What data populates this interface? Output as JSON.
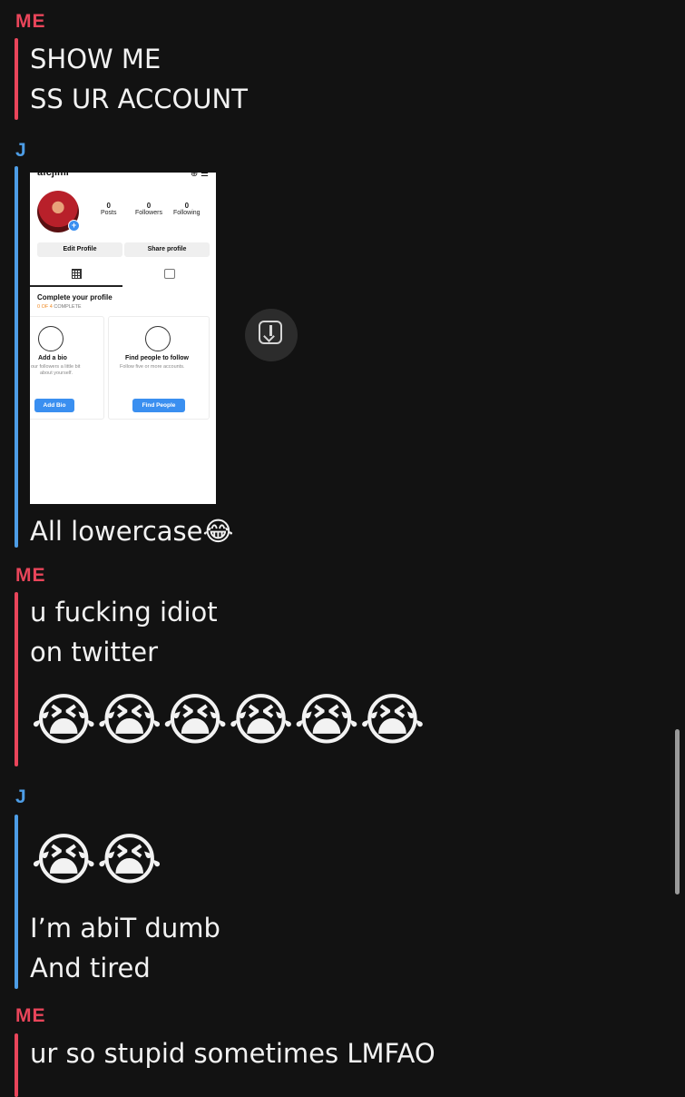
{
  "messages": [
    {
      "sender": "ME",
      "lines": [
        "SHOW ME",
        "SS UR ACCOUNT"
      ]
    },
    {
      "sender": "J",
      "screenshot": {
        "handle": "afcjimi",
        "stats": [
          {
            "value": "0",
            "label": "Posts"
          },
          {
            "value": "0",
            "label": "Followers"
          },
          {
            "value": "0",
            "label": "Following"
          }
        ],
        "buttons": [
          "Edit Profile",
          "Share profile"
        ],
        "complete_title": "Complete your profile",
        "complete_progress_highlight": "0 OF 4",
        "complete_progress_rest": " COMPLETE",
        "cards": [
          {
            "title": "Add a bio",
            "desc_1": "our followers a little bit",
            "desc_2": "about yourself.",
            "button": "Add Bio"
          },
          {
            "title": "Find people to follow",
            "desc_1": "Follow five or more accounts.",
            "desc_2": "",
            "button": "Find People"
          }
        ]
      },
      "lines": [
        "All lowercase😂"
      ]
    },
    {
      "sender": "ME",
      "lines": [
        "u fucking idiot",
        "on twitter"
      ],
      "emojis": "😭😭😭😭😭😭"
    },
    {
      "sender": "J",
      "emojis": "😭😭",
      "lines": [
        "I’m abiT dumb",
        "And tired"
      ]
    },
    {
      "sender": "ME",
      "lines": [
        "ur so stupid sometimes LMFAO"
      ]
    }
  ],
  "colors": {
    "me": "#e9455a",
    "j": "#4d9de6",
    "background": "#121212"
  }
}
